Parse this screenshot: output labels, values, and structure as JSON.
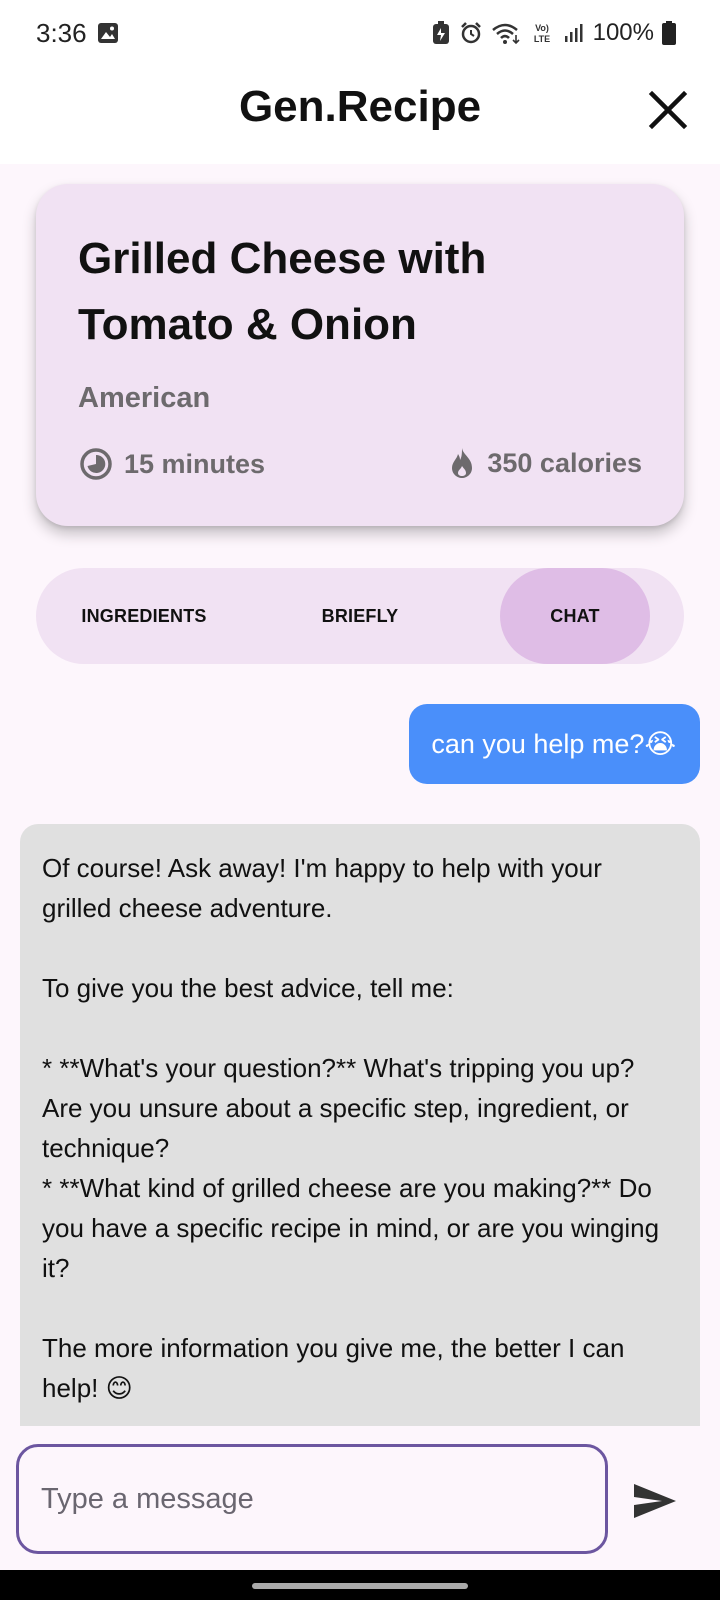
{
  "status_bar": {
    "time": "3:36",
    "network": "VoLTE",
    "battery": "100%",
    "icons": [
      "gallery-icon",
      "battery-saver-icon",
      "alarm-icon",
      "wifi-icon",
      "volte-icon",
      "signal-icon",
      "battery-icon"
    ]
  },
  "app_bar": {
    "title": "Gen.Recipe",
    "close_icon": "close-icon"
  },
  "recipe": {
    "title": "Grilled Cheese with Tomato & Onion",
    "cuisine": "American",
    "time": "15 minutes",
    "calories": "350 calories",
    "time_icon": "clock-icon",
    "calories_icon": "flame-icon"
  },
  "tabs": {
    "items": [
      {
        "label": "INGREDIENTS"
      },
      {
        "label": "BRIEFLY"
      },
      {
        "label": "CHAT"
      }
    ],
    "selected": "CHAT"
  },
  "chat": {
    "messages": [
      {
        "sender": "user",
        "text": "can you help me?😭"
      },
      {
        "sender": "bot",
        "lines": [
          "Of course! Ask away! I'm happy to help with your grilled cheese adventure.",
          "",
          "To give you the best advice, tell me:",
          "",
          "* **What's your question?**  What's tripping you up? Are you unsure about a specific step, ingredient, or technique?",
          "* **What kind of grilled cheese are you making?** Do you have a specific recipe in mind, or are you winging it?",
          "",
          "The more information you give me, the better I can help! 😊"
        ]
      }
    ]
  },
  "composer": {
    "placeholder": "Type a message",
    "value": "",
    "send_icon": "send-icon"
  },
  "colors": {
    "background": "#fdf6fc",
    "card": "#f1e2f3",
    "tab_selected": "#dfbde6",
    "user_bubble": "#4a8ffa",
    "bot_bubble": "#e0e0e0",
    "input_border": "#6c56a0"
  }
}
